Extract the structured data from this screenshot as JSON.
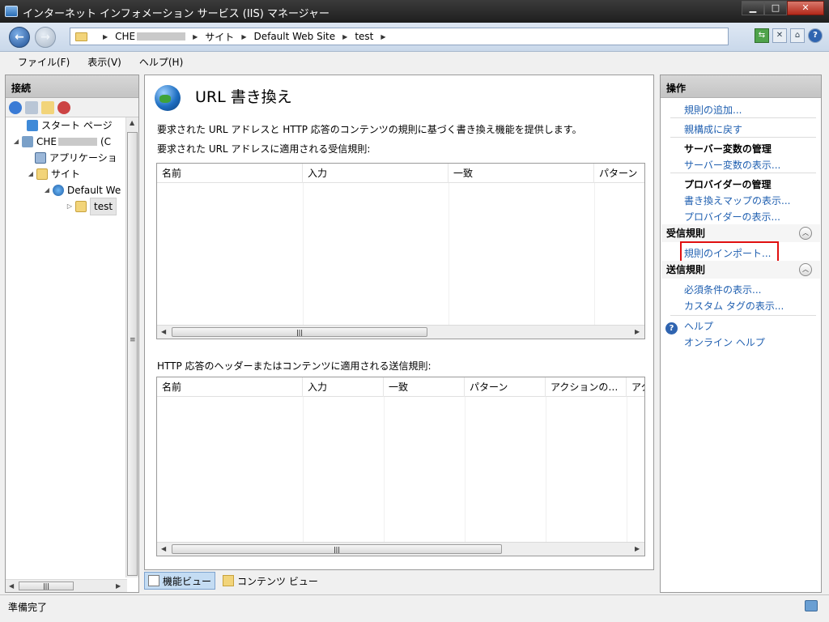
{
  "window": {
    "title": "インターネット インフォメーション サービス (IIS) マネージャー",
    "minimize": "▁",
    "maximize": "□",
    "close": "✕"
  },
  "address": {
    "crumbs": [
      "CHE",
      "サイト",
      "Default Web Site",
      "test"
    ]
  },
  "menu": {
    "items": [
      "ファイル(F)",
      "表示(V)",
      "ヘルプ(H)"
    ]
  },
  "connections": {
    "header": "接続",
    "tree": [
      {
        "label": "スタート ページ"
      },
      {
        "label": "CHE",
        "suffix": "(C"
      },
      {
        "label": "アプリケーショ"
      },
      {
        "label": "サイト"
      },
      {
        "label": "Default We"
      },
      {
        "label": "test"
      }
    ]
  },
  "feature": {
    "title": "URL 書き換え",
    "description": "要求された URL アドレスと HTTP 応答のコンテンツの規則に基づく書き換え機能を提供します。",
    "inbound_caption": "要求された URL アドレスに適用される受信規則:",
    "outbound_caption": "HTTP 応答のヘッダーまたはコンテンツに適用される送信規則:",
    "inbound_columns": [
      "名前",
      "入力",
      "一致",
      "パターン"
    ],
    "outbound_columns": [
      "名前",
      "入力",
      "一致",
      "パターン",
      "アクションの…",
      "アク"
    ]
  },
  "views": {
    "features": "機能ビュー",
    "content": "コンテンツ ビュー"
  },
  "actions": {
    "header": "操作",
    "add_rule": "規則の追加...",
    "revert_parent": "親構成に戻す",
    "server_vars_head": "サーバー変数の管理",
    "server_vars_view": "サーバー変数の表示...",
    "providers_head": "プロバイダーの管理",
    "rewrite_maps": "書き換えマップの表示...",
    "providers_view": "プロバイダーの表示...",
    "inbound_section": "受信規則",
    "import_rules": "規則のインポート...",
    "outbound_section": "送信規則",
    "preconditions": "必須条件の表示...",
    "custom_tags": "カスタム タグの表示...",
    "help": "ヘルプ",
    "online_help": "オンライン ヘルプ"
  },
  "status": {
    "text": "準備完了"
  },
  "colors": {
    "link": "#1f5fb0",
    "highlight": "#e01010"
  }
}
